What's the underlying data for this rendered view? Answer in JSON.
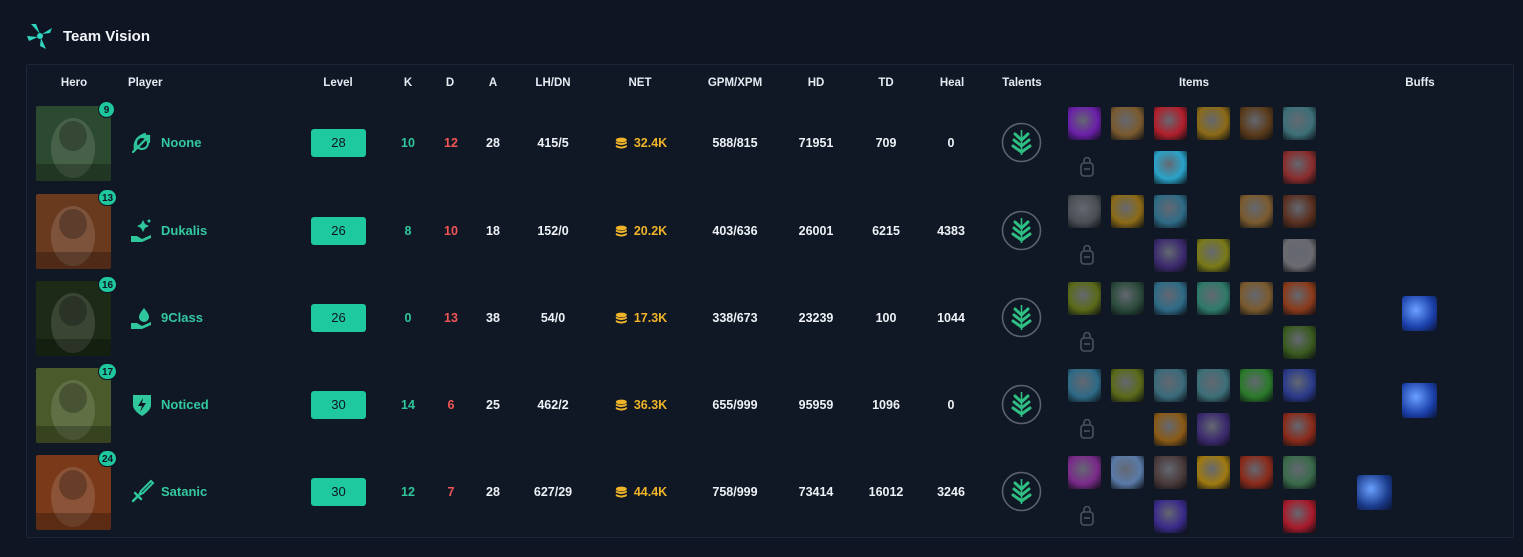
{
  "title": "Team Vision",
  "columns": {
    "hero": "Hero",
    "player": "Player",
    "level": "Level",
    "k": "K",
    "d": "D",
    "a": "A",
    "lhdn": "LH/DN",
    "net": "NET",
    "gpmxpm": "GPM/XPM",
    "hd": "HD",
    "td": "TD",
    "heal": "Heal",
    "talents": "Talents",
    "items": "Items",
    "buffs": "Buffs"
  },
  "rows": [
    {
      "hero_level": "9",
      "player": "Noone",
      "level": "28",
      "k": "10",
      "d": "12",
      "a": "28",
      "lhdn": "415/5",
      "net": "32.4K",
      "gpmxpm": "588/815",
      "hd": "71951",
      "td": "709",
      "heal": "0",
      "role_icon": "bow-icon",
      "hero_color": "#2c4a2f",
      "items_top": [
        "#6a1fa8",
        "#7a5a2e",
        "#b11f2b",
        "#8b6a16",
        "#5a3a1a",
        "#3d6f78"
      ],
      "items_bottom": [
        null,
        "#2aa3c9",
        null,
        null,
        "#8a2c2c"
      ],
      "buffs": []
    },
    {
      "hero_level": "13",
      "player": "Dukalis",
      "level": "26",
      "k": "8",
      "d": "10",
      "a": "18",
      "lhdn": "152/0",
      "net": "20.2K",
      "gpmxpm": "403/636",
      "hd": "26001",
      "td": "6215",
      "heal": "4383",
      "role_icon": "heal-hand-icon",
      "hero_color": "#6a3a1f",
      "items_top": [
        "#4a4f55",
        "#8b6a16",
        "#2e6a86",
        null,
        "#7a5a2e",
        "#5a3020"
      ],
      "items_bottom": [
        null,
        "#3b2a6e",
        "#7a7a18",
        null,
        "#6a6a70"
      ],
      "buffs": []
    },
    {
      "hero_level": "16",
      "player": "9Class",
      "level": "26",
      "k": "0",
      "d": "13",
      "a": "38",
      "lhdn": "54/0",
      "net": "17.3K",
      "gpmxpm": "338/673",
      "hd": "23239",
      "td": "100",
      "heal": "1044",
      "role_icon": "hand-drop-icon",
      "hero_color": "#1d2a16",
      "items_top": [
        "#5a6a18",
        "#2a4a3a",
        "#2e6a86",
        "#2f7a6a",
        "#7a5a2e",
        "#8a3a1a"
      ],
      "items_bottom": [
        null,
        null,
        null,
        null,
        "#3a5a1f"
      ],
      "buffs": [
        "#1a3fa8"
      ]
    },
    {
      "hero_level": "17",
      "player": "Noticed",
      "level": "30",
      "k": "14",
      "d": "6",
      "a": "25",
      "lhdn": "462/2",
      "net": "36.3K",
      "gpmxpm": "655/999",
      "hd": "95959",
      "td": "1096",
      "heal": "0",
      "role_icon": "shield-bolt-icon",
      "hero_color": "#4a5a2a",
      "items_top": [
        "#2e6a86",
        "#5a6a18",
        "#3a6a7a",
        "#3d6f78",
        "#2a7a2a",
        "#2a3a8a"
      ],
      "items_bottom": [
        null,
        "#8a5a16",
        "#3b2a6e",
        null,
        "#8a2a1a"
      ],
      "buffs": [
        "#1a3fa8"
      ]
    },
    {
      "hero_level": "24",
      "player": "Satanic",
      "level": "30",
      "k": "12",
      "d": "7",
      "a": "28",
      "lhdn": "627/29",
      "net": "44.4K",
      "gpmxpm": "758/999",
      "hd": "73414",
      "td": "16012",
      "heal": "3246",
      "role_icon": "sword-icon",
      "hero_color": "#7a3a1a",
      "items_top": [
        "#7a2a8a",
        "#5a7aa8",
        "#4a3a3a",
        "#a07a10",
        "#8a2a1a",
        "#3a6a4a"
      ],
      "items_bottom": [
        null,
        "#3a2a8a",
        null,
        null,
        "#a81a2a"
      ],
      "buffs": [
        "#1a3a8a"
      ]
    }
  ],
  "colors": {
    "accent": "#1fc99e",
    "kills": "#2fc79b",
    "deaths": "#f05656",
    "gold": "#f0b429"
  }
}
